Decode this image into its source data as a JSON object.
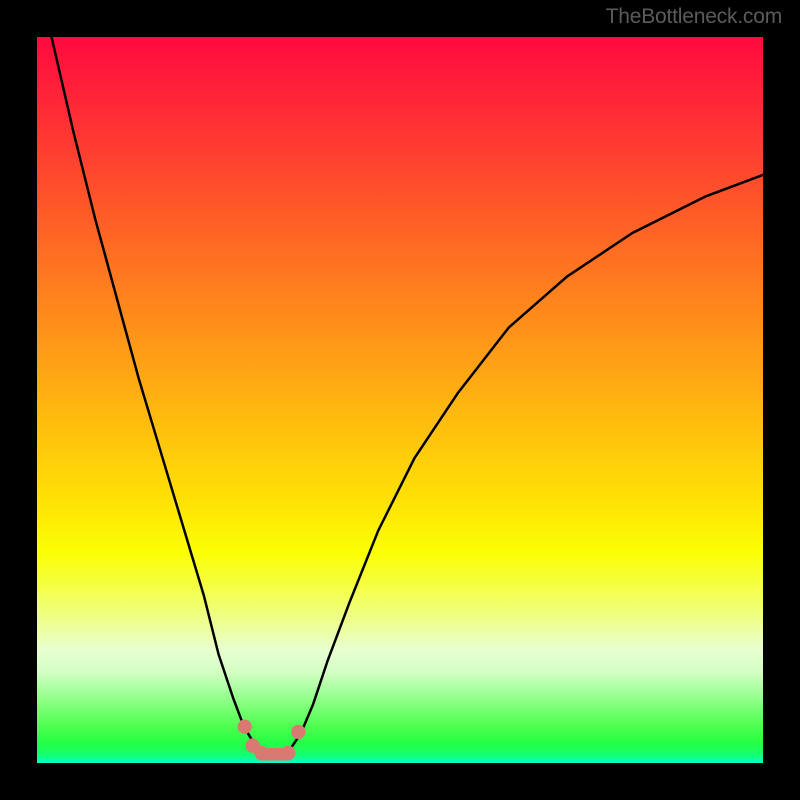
{
  "watermark": "TheBottleneck.com",
  "colors": {
    "marker": "#d87a72",
    "curve": "#000000"
  },
  "chart_data": {
    "type": "line",
    "title": "",
    "xlabel": "",
    "ylabel": "",
    "xlim": [
      0,
      100
    ],
    "ylim": [
      0,
      100
    ],
    "grid": false,
    "legend": false,
    "note": "Values estimated from pixel positions; no axis labels present in image.",
    "series": [
      {
        "name": "bottleneck-curve",
        "x": [
          2,
          5,
          8,
          11,
          14,
          17,
          20,
          23,
          25,
          27,
          28.5,
          30.2,
          31.5,
          33,
          34.8,
          36.3,
          38,
          40,
          43,
          47,
          52,
          58,
          65,
          73,
          82,
          92,
          100
        ],
        "y": [
          100,
          87,
          75,
          64,
          53,
          43,
          33,
          23,
          15,
          9,
          5,
          2.2,
          1.4,
          1.2,
          1.8,
          4,
          8,
          14,
          22,
          32,
          42,
          51,
          60,
          67,
          73,
          78,
          81
        ]
      }
    ],
    "markers": [
      {
        "x": 28.6,
        "y": 5.0
      },
      {
        "x": 29.7,
        "y": 2.4
      },
      {
        "x": 30.9,
        "y": 1.4
      },
      {
        "x": 34.6,
        "y": 1.4
      },
      {
        "x": 36.0,
        "y": 4.3
      }
    ],
    "flat_segment": {
      "x1": 30.9,
      "x2": 34.6,
      "y": 1.2
    }
  }
}
